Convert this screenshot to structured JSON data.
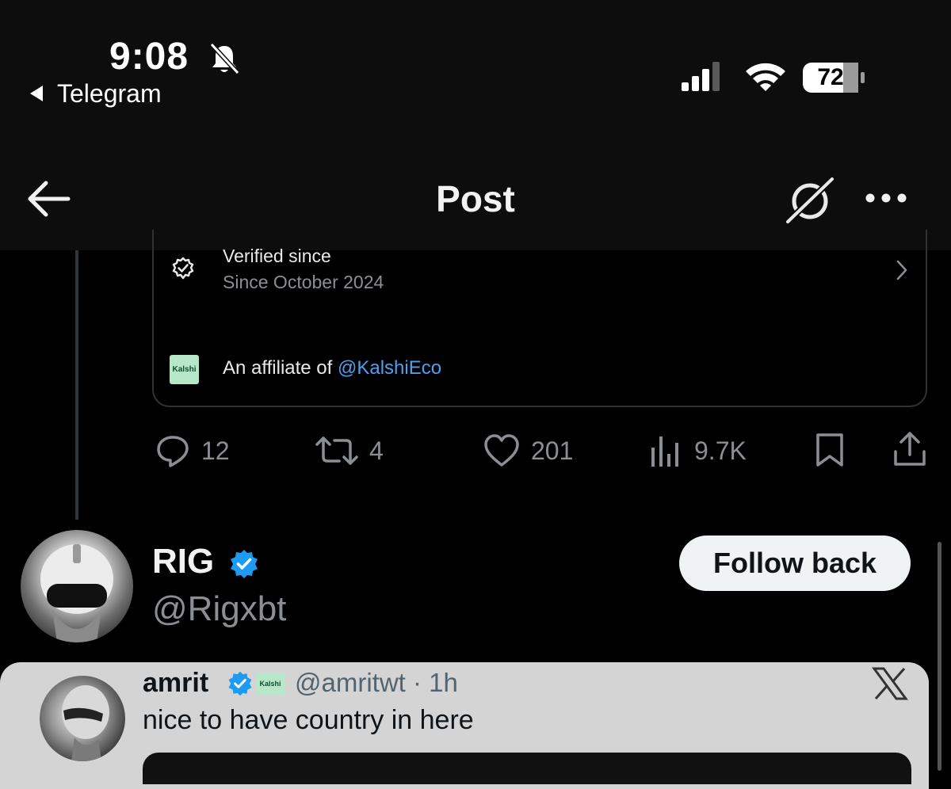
{
  "status_bar": {
    "time": "9:08",
    "back_app": "Telegram",
    "battery": "72"
  },
  "header": {
    "title": "Post"
  },
  "card": {
    "verified_title": "Verified since",
    "verified_sub": "Since October 2024",
    "kalshi_label": "Kalshi",
    "affiliate_prefix": "An affiliate of ",
    "affiliate_handle": "@KalshiEco"
  },
  "actions": {
    "replies": "12",
    "reposts": "4",
    "likes": "201",
    "views": "9.7K"
  },
  "user": {
    "name": "RIG",
    "handle": "@Rigxbt",
    "follow_label": "Follow back"
  },
  "embedded_post": {
    "name": "amrit",
    "kalshi_label": "Kalshi",
    "handle_time": "@amritwt · 1h",
    "text": "nice to have country in here"
  },
  "colors": {
    "accent_blue": "#4ea0ef",
    "verified_blue": "#1d9bf0",
    "muted": "#8b8f94"
  }
}
